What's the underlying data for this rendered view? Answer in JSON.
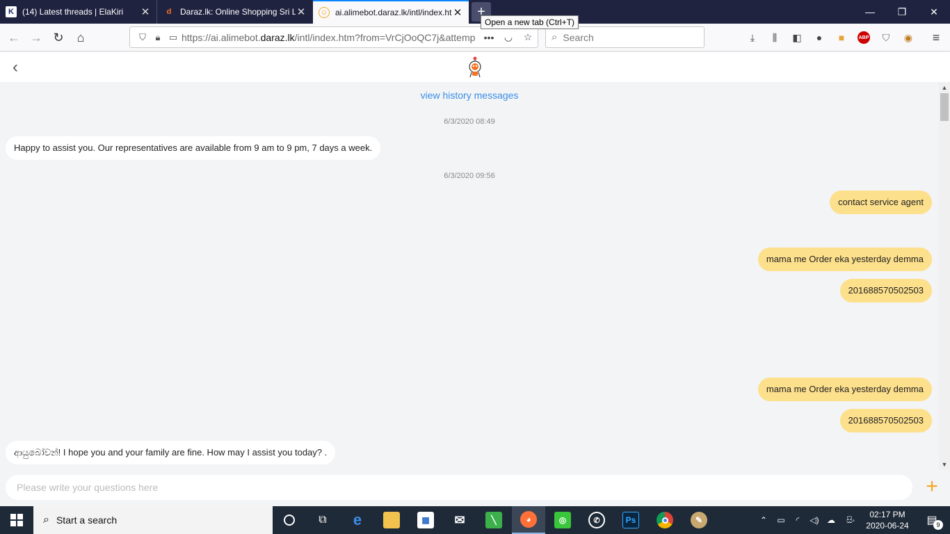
{
  "browser": {
    "tabs": [
      {
        "title": "(14) Latest threads | ElaKiri",
        "favicon": "elakiri-icon",
        "active": false
      },
      {
        "title": "Daraz.lk: Online Shopping Sri Lanka",
        "favicon": "daraz-icon",
        "active": false
      },
      {
        "title": "ai.alimebot.daraz.lk/intl/index.htm",
        "favicon": "alimebot-icon",
        "active": true
      }
    ],
    "new_tab_tooltip": "Open a new tab (Ctrl+T)",
    "url_prefix": "https://ai.alimebot.",
    "url_domain": "daraz.lk",
    "url_suffix": "/intl/index.htm?from=VrCjOoQC7j&attemp",
    "search_placeholder": "Search",
    "toolbar_icons": [
      "downloads-icon",
      "library-icon",
      "sidebar-icon",
      "account-icon",
      "colorful-extension-icon",
      "adblock-icon",
      "shield-extension-icon",
      "owl-extension-icon",
      "menu-icon"
    ]
  },
  "app": {
    "history_link": "view history messages",
    "input_placeholder": "Please write your questions here"
  },
  "messages": [
    {
      "type": "timestamp",
      "text": "6/3/2020 08:49"
    },
    {
      "type": "in",
      "text": "Happy to assist you. Our representatives are available from 9 am to 9 pm, 7 days a week."
    },
    {
      "type": "timestamp",
      "text": "6/3/2020 09:56"
    },
    {
      "type": "out",
      "text": "contact service agent"
    },
    {
      "type": "out",
      "text": "mama me Order eka yesterday demma"
    },
    {
      "type": "out",
      "text": "201688570502503"
    },
    {
      "type": "out",
      "text": "mama me Order eka yesterday demma"
    },
    {
      "type": "out",
      "text": "201688570502503"
    },
    {
      "type": "in",
      "text": "ආයුබෝවන්! I hope you and your family are fine. How may I assist you today? ."
    }
  ],
  "taskbar": {
    "search_text": "Start a search",
    "time": "02:17 PM",
    "date": "2020-06-24",
    "notification_count": "9",
    "lang": "සිං",
    "colors": {
      "bar": "#1f2a38",
      "accent": "#f5a623",
      "bubble_out": "#fde08c",
      "link": "#3a8ee6"
    }
  }
}
